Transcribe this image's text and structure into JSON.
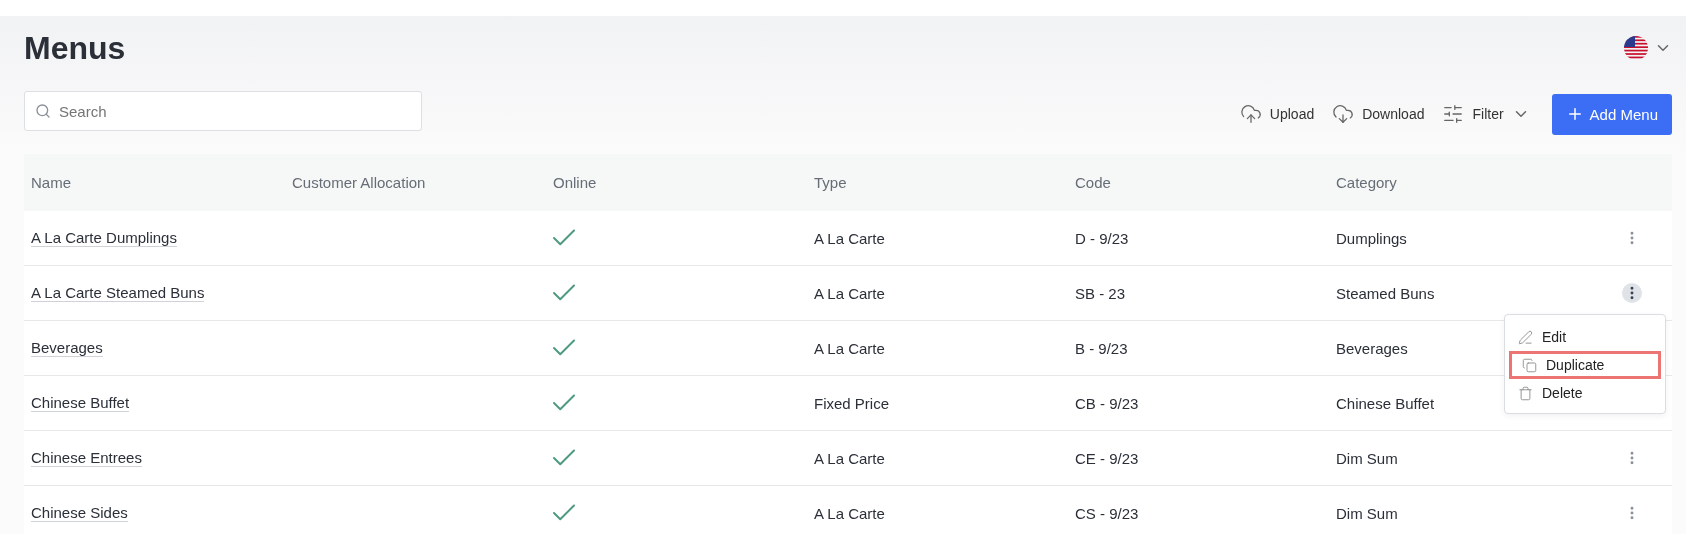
{
  "page": {
    "title": "Menus"
  },
  "search": {
    "placeholder": "Search"
  },
  "toolbar": [
    {
      "kind": "upload",
      "label": "Upload"
    },
    {
      "kind": "download",
      "label": "Download"
    },
    {
      "kind": "filter",
      "label": "Filter"
    }
  ],
  "add_button": {
    "label": "Add Menu"
  },
  "table": {
    "columns": [
      "Name",
      "Customer Allocation",
      "Online",
      "Type",
      "Code",
      "Category"
    ],
    "rows": [
      {
        "name": "A La Carte Dumplings",
        "customer_allocation": "",
        "online": true,
        "type": "A La Carte",
        "code": "D - 9/23",
        "category": "Dumplings",
        "menu_open": false
      },
      {
        "name": "A La Carte Steamed Buns",
        "customer_allocation": "",
        "online": true,
        "type": "A La Carte",
        "code": "SB - 23",
        "category": "Steamed Buns",
        "menu_open": true
      },
      {
        "name": "Beverages",
        "customer_allocation": "",
        "online": true,
        "type": "A La Carte",
        "code": "B - 9/23",
        "category": "Beverages",
        "menu_open": false
      },
      {
        "name": "Chinese Buffet",
        "customer_allocation": "",
        "online": true,
        "type": "Fixed Price",
        "code": "CB - 9/23",
        "category": "Chinese Buffet",
        "menu_open": false
      },
      {
        "name": "Chinese Entrees",
        "customer_allocation": "",
        "online": true,
        "type": "A La Carte",
        "code": "CE - 9/23",
        "category": "Dim Sum",
        "menu_open": false
      },
      {
        "name": "Chinese Sides",
        "customer_allocation": "",
        "online": true,
        "type": "A La Carte",
        "code": "CS - 9/23",
        "category": "Dim Sum",
        "menu_open": false
      }
    ]
  },
  "row_menu": [
    {
      "kind": "edit",
      "label": "Edit",
      "highlighted": false
    },
    {
      "kind": "duplicate",
      "label": "Duplicate",
      "highlighted": true
    },
    {
      "kind": "delete",
      "label": "Delete",
      "highlighted": false
    }
  ]
}
